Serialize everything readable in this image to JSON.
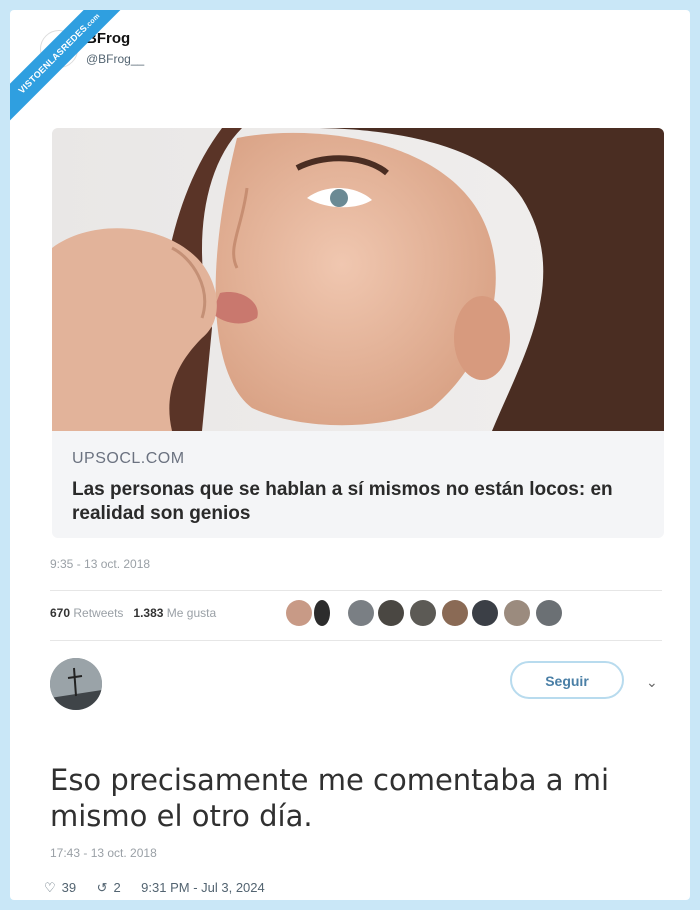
{
  "watermark": {
    "text": "VISTOENLASREDES",
    "sub": ".com"
  },
  "author": {
    "name": "BFrog",
    "handle": "@BFrog__"
  },
  "quoted_card": {
    "site": "UPSOCL.COM",
    "headline": "Las personas que se hablan a sí mismos no están locos: en realidad son genios"
  },
  "tweet1": {
    "timestamp": "9:35 - 13 oct. 2018",
    "retweets_count": "670",
    "retweets_label": "Retweets",
    "likes_count": "1.383",
    "likes_label": "Me gusta"
  },
  "tweet2": {
    "follow_label": "Seguir",
    "text": "Eso precisamente me comentaba a mi mismo el otro día.",
    "timestamp": "17:43 - 13 oct. 2018"
  },
  "footer": {
    "likes": "39",
    "retweets": "2",
    "posted": "9:31 PM - Jul 3, 2024"
  },
  "colors": {
    "background": "#c9e7f7",
    "ribbon": "#2f9fe0",
    "card": "#ffffff"
  },
  "icons": {
    "like": "heart-icon",
    "retweet": "retweet-icon",
    "more": "chevron-down-icon"
  }
}
